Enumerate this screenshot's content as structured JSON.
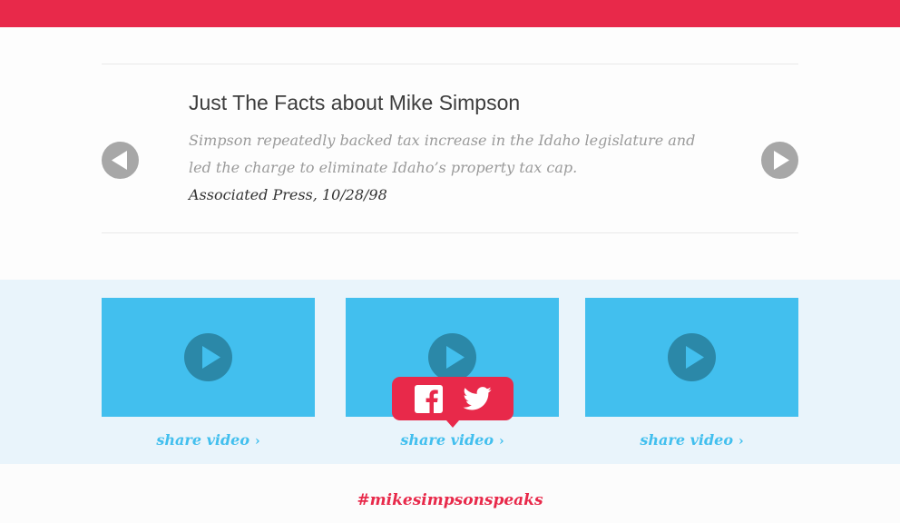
{
  "colors": {
    "brand_red": "#e8294a",
    "video_blue": "#42bfee",
    "arrow_gray": "#a7a7a7",
    "panel_bg": "#e9f4fb"
  },
  "facts": {
    "title": "Just The Facts about Mike Simpson",
    "quote": "Simpson repeatedly backed tax increase in the Idaho legislature and led the charge to eliminate Idaho’s property tax cap.",
    "source": "Associated Press, 10/28/98",
    "prev_icon": "triangle-left-icon",
    "next_icon": "triangle-right-icon"
  },
  "videos": [
    {
      "share_label": "share video",
      "icon": "play-icon"
    },
    {
      "share_label": "share video",
      "icon": "play-icon"
    },
    {
      "share_label": "share video",
      "icon": "play-icon"
    }
  ],
  "share_popup": {
    "icons": [
      "facebook-icon",
      "twitter-icon"
    ]
  },
  "hashtag": "#mikesimpsonspeaks"
}
